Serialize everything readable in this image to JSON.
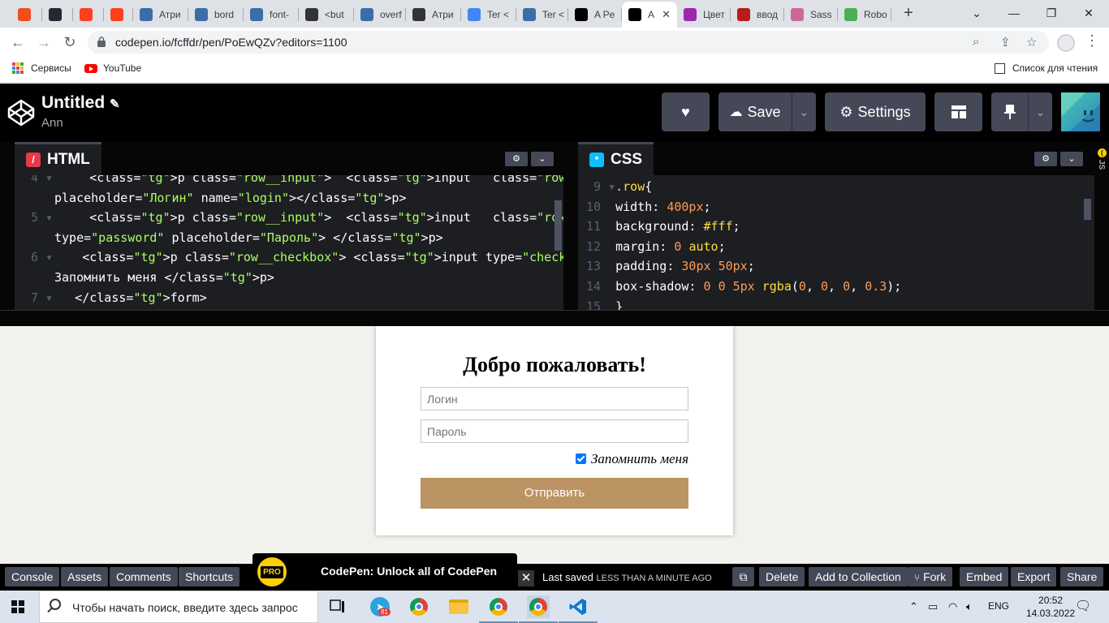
{
  "browser": {
    "tabs": [
      {
        "label": "",
        "favicon": "figma-icon",
        "color": "#f24e1e"
      },
      {
        "label": "",
        "favicon": "github-icon",
        "color": "#24292f"
      },
      {
        "label": "",
        "favicon": "yandex-icon",
        "color": "#fc3f1d"
      },
      {
        "label": "",
        "favicon": "yandex-icon",
        "color": "#fc3f1d"
      },
      {
        "label": "Атри",
        "favicon": "htmlbook-icon",
        "color": "#3b6ea8"
      },
      {
        "label": "bord",
        "favicon": "htmlbook-icon",
        "color": "#3b6ea8"
      },
      {
        "label": "font-",
        "favicon": "htmlbook-icon",
        "color": "#3b6ea8"
      },
      {
        "label": "<but",
        "favicon": "question-icon",
        "color": "#333333"
      },
      {
        "label": "overf",
        "favicon": "htmlbook-icon",
        "color": "#3b6ea8"
      },
      {
        "label": "Атри",
        "favicon": "question-icon",
        "color": "#333333"
      },
      {
        "label": "Ter <",
        "favicon": "chrome-color-icon",
        "color": "#4285f4"
      },
      {
        "label": "Ter <",
        "favicon": "htmlbook-icon",
        "color": "#3b6ea8"
      },
      {
        "label": "A Pe",
        "favicon": "codepen-icon",
        "color": "#000000"
      },
      {
        "label": "A",
        "favicon": "codepen-icon",
        "color": "#000000",
        "active": true
      },
      {
        "label": "Цвет",
        "favicon": "color-wheel-icon",
        "color": "#9c27b0"
      },
      {
        "label": "ввод",
        "favicon": "cinema-icon",
        "color": "#b71c1c"
      },
      {
        "label": "Sass",
        "favicon": "sass-icon",
        "color": "#cd6799"
      },
      {
        "label": "Robo",
        "favicon": "roboto-icon",
        "color": "#4caf50"
      }
    ],
    "url": "codepen.io/fcffdr/pen/PoEwQZv?editors=1100",
    "bookmarks": {
      "apps_label": "Сервисы",
      "youtube_label": "YouTube",
      "reading_list_label": "Список для чтения"
    }
  },
  "codepen": {
    "title": "Untitled",
    "author": "Ann",
    "save_label": "Save",
    "settings_label": "Settings",
    "html_panel": {
      "label": "HTML",
      "lines": [
        {
          "n": "4",
          "text": "    <p class=\"row__input\">  <input   class=\"row__input__input\""
        },
        {
          "n": "",
          "text": "placeholder=\"Логин\" name=\"login\"></p>"
        },
        {
          "n": "5",
          "text": "    <p class=\"row__input\">  <input   class=\"row__input__input\""
        },
        {
          "n": "",
          "text": "type=\"password\" placeholder=\"Пароль\"> </p>"
        },
        {
          "n": "6",
          "text": "   <p class=\"row__checkbox\"> <input type=\"checkbox\" checked>"
        },
        {
          "n": "",
          "text": "Запомнить меня </p>"
        },
        {
          "n": "7",
          "text": "  </form>"
        }
      ]
    },
    "css_panel": {
      "label": "CSS",
      "lines": [
        {
          "n": "9",
          "text": ".row{"
        },
        {
          "n": "10",
          "text": "width: 400px;"
        },
        {
          "n": "11",
          "text": "background: #fff;"
        },
        {
          "n": "12",
          "text": "margin: 0 auto;"
        },
        {
          "n": "13",
          "text": "padding: 30px 50px;"
        },
        {
          "n": "14",
          "text": "box-shadow: 0 0 5px rgba(0, 0, 0, 0.3);"
        },
        {
          "n": "15",
          "text": "}"
        }
      ]
    },
    "js_label": "JS",
    "preview": {
      "heading": "Добро пожаловать!",
      "login_placeholder": "Логин",
      "password_placeholder": "Пароль",
      "remember_label": "Запомнить меня",
      "submit_label": "Отправить"
    },
    "footer": {
      "console": "Console",
      "assets": "Assets",
      "comments": "Comments",
      "shortcuts": "Shortcuts",
      "promo_badge": "PRO",
      "promo_text": "CodePen: Unlock all of CodePen",
      "last_saved_label": "Last saved",
      "last_saved_value": "LESS THAN A MINUTE AGO",
      "delete": "Delete",
      "add_to_collection": "Add to Collection",
      "fork": "Fork",
      "embed": "Embed",
      "export": "Export",
      "share": "Share"
    }
  },
  "taskbar": {
    "search_placeholder": "Чтобы начать поиск, введите здесь запрос",
    "telegram_badge": "81",
    "language": "ENG",
    "time": "20:52",
    "date": "14.03.2022"
  }
}
